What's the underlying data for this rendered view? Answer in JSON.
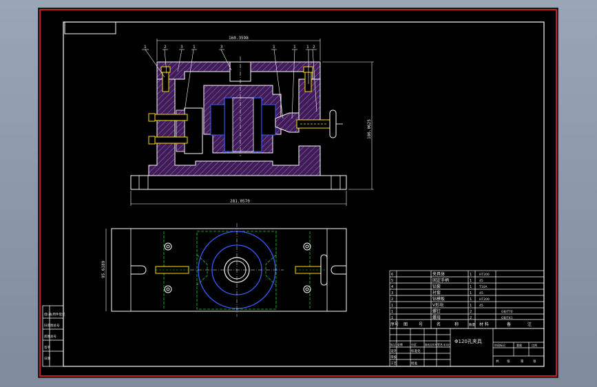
{
  "drawing": {
    "top_dims": {
      "width": "160.3598",
      "height": "186.0625",
      "base_width": "281.0570"
    },
    "plan_dim": "95.6189",
    "balloons": [
      "1",
      "2",
      "3",
      "1",
      "3",
      "1",
      "1",
      "1",
      "2"
    ],
    "bom": {
      "rows": [
        [
          "6",
          "夹具体",
          "1",
          "HT200",
          ""
        ],
        [
          "5",
          "固定手柄",
          "1",
          "45",
          ""
        ],
        [
          "4",
          "钻套",
          "1",
          "T10A",
          ""
        ],
        [
          "3",
          "衬套",
          "1",
          "45",
          ""
        ],
        [
          "2",
          "钻模板",
          "1",
          "HT200",
          ""
        ],
        [
          "1",
          "V形块",
          "1",
          "45",
          ""
        ],
        [
          "1",
          "螺钉",
          "2",
          "",
          "GB/T70"
        ],
        [
          "1",
          "螺母",
          "2",
          "",
          "GB/T41"
        ]
      ],
      "header": [
        "序号",
        "图",
        "号",
        "名",
        "称",
        "数量",
        "材 料",
        "备",
        "注"
      ]
    },
    "title_block": {
      "part_name": "Φ120孔夹具",
      "rows_left": [
        "标记",
        "处数",
        "分区",
        "更改文件号",
        "签名",
        "年月日"
      ],
      "design": "设计",
      "std": "标准化",
      "review": "审核",
      "process": "工艺",
      "approve": "批准",
      "stage_headers": [
        "阶段标记",
        "重量",
        "比例"
      ],
      "sheet": [
        "共",
        "张",
        "第",
        "张"
      ]
    },
    "side_table": [
      "借(通)用件登记",
      "旧底图总号",
      "底图总号",
      "签字",
      "日期"
    ]
  }
}
